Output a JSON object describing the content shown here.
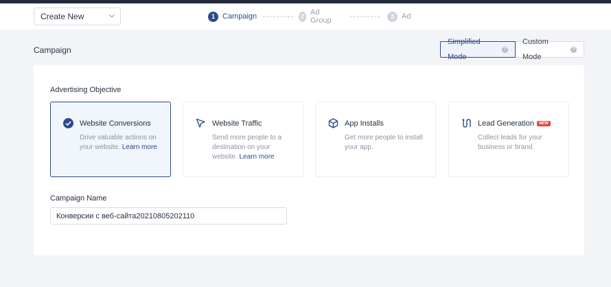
{
  "header": {
    "create_select": {
      "value": "Create New",
      "icon": "chevron-down-icon"
    },
    "steps": [
      {
        "number": "1",
        "label": "Campaign",
        "active": true
      },
      {
        "number": "2",
        "label": "Ad Group",
        "active": false
      },
      {
        "number": "3",
        "label": "Ad",
        "active": false
      }
    ]
  },
  "section": {
    "title": "Campaign",
    "modes": [
      {
        "label": "Simplified Mode",
        "active": true,
        "icon": "help-icon"
      },
      {
        "label": "Custom Mode",
        "active": false,
        "icon": "help-icon"
      }
    ]
  },
  "objective": {
    "title": "Advertising Objective",
    "cards": [
      {
        "title": "Website Conversions",
        "desc": "Drive valuable actions on your website.",
        "link": "Learn more",
        "icon": "check-circle-icon",
        "selected": true
      },
      {
        "title": "Website Traffic",
        "desc": "Send more people to a destination on your website.",
        "link": "Learn more",
        "icon": "cursor-arrow-icon",
        "selected": false
      },
      {
        "title": "App Installs",
        "desc": "Get more people to install your app.",
        "link": "",
        "icon": "cube-icon",
        "selected": false
      },
      {
        "title": "Lead Generation",
        "desc": "Collect leads for your business or brand.",
        "link": "",
        "icon": "lead-funnel-icon",
        "badge": "NEW",
        "selected": false
      }
    ]
  },
  "campaign_name": {
    "label": "Campaign Name",
    "value": "Конверсии с веб-сайта20210805202110"
  },
  "colors": {
    "accent": "#2d4a8a",
    "badge": "#e8453c",
    "background": "#f3f4f7"
  }
}
